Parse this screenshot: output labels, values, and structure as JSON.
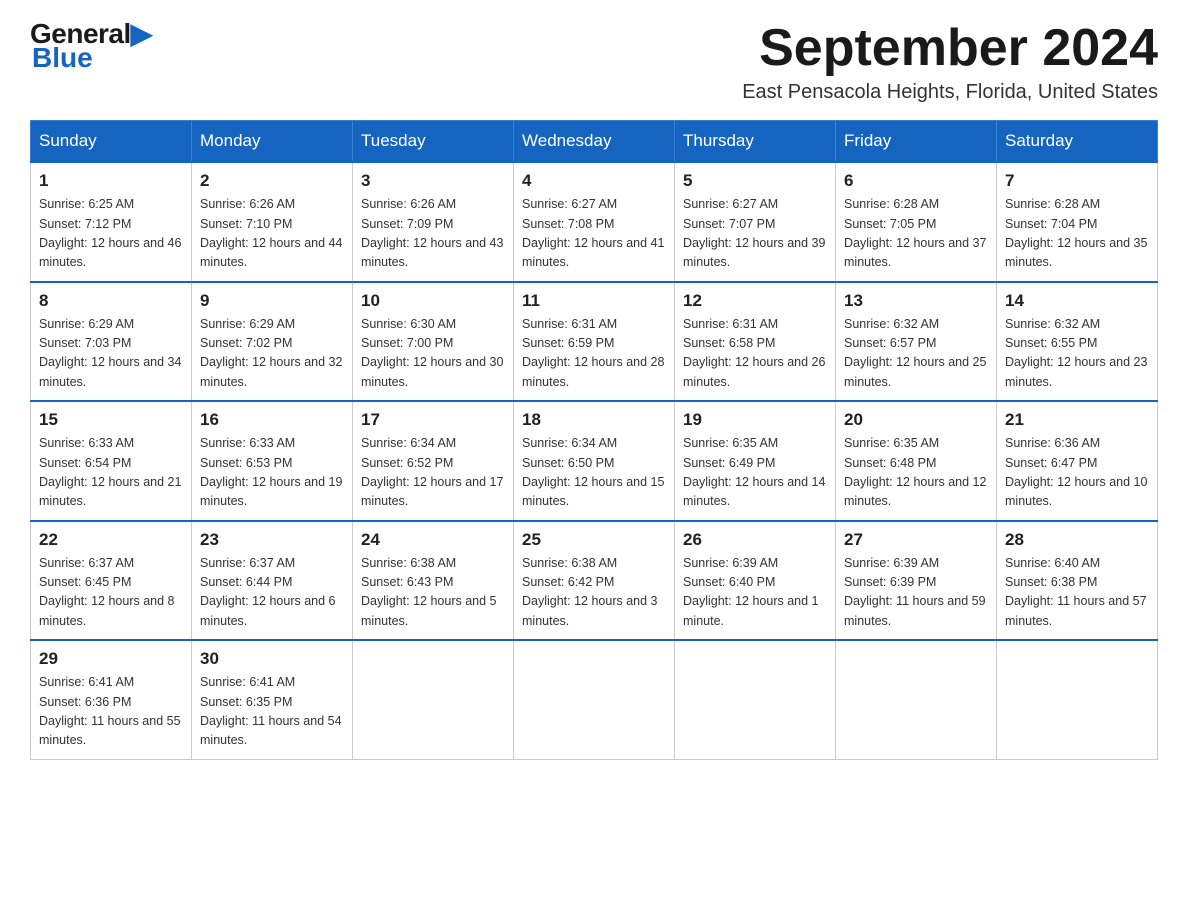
{
  "header": {
    "logo_general": "General",
    "logo_blue": "Blue",
    "month_title": "September 2024",
    "location": "East Pensacola Heights, Florida, United States"
  },
  "weekdays": [
    "Sunday",
    "Monday",
    "Tuesday",
    "Wednesday",
    "Thursday",
    "Friday",
    "Saturday"
  ],
  "weeks": [
    [
      {
        "day": "1",
        "sunrise": "6:25 AM",
        "sunset": "7:12 PM",
        "daylight": "12 hours and 46 minutes."
      },
      {
        "day": "2",
        "sunrise": "6:26 AM",
        "sunset": "7:10 PM",
        "daylight": "12 hours and 44 minutes."
      },
      {
        "day": "3",
        "sunrise": "6:26 AM",
        "sunset": "7:09 PM",
        "daylight": "12 hours and 43 minutes."
      },
      {
        "day": "4",
        "sunrise": "6:27 AM",
        "sunset": "7:08 PM",
        "daylight": "12 hours and 41 minutes."
      },
      {
        "day": "5",
        "sunrise": "6:27 AM",
        "sunset": "7:07 PM",
        "daylight": "12 hours and 39 minutes."
      },
      {
        "day": "6",
        "sunrise": "6:28 AM",
        "sunset": "7:05 PM",
        "daylight": "12 hours and 37 minutes."
      },
      {
        "day": "7",
        "sunrise": "6:28 AM",
        "sunset": "7:04 PM",
        "daylight": "12 hours and 35 minutes."
      }
    ],
    [
      {
        "day": "8",
        "sunrise": "6:29 AM",
        "sunset": "7:03 PM",
        "daylight": "12 hours and 34 minutes."
      },
      {
        "day": "9",
        "sunrise": "6:29 AM",
        "sunset": "7:02 PM",
        "daylight": "12 hours and 32 minutes."
      },
      {
        "day": "10",
        "sunrise": "6:30 AM",
        "sunset": "7:00 PM",
        "daylight": "12 hours and 30 minutes."
      },
      {
        "day": "11",
        "sunrise": "6:31 AM",
        "sunset": "6:59 PM",
        "daylight": "12 hours and 28 minutes."
      },
      {
        "day": "12",
        "sunrise": "6:31 AM",
        "sunset": "6:58 PM",
        "daylight": "12 hours and 26 minutes."
      },
      {
        "day": "13",
        "sunrise": "6:32 AM",
        "sunset": "6:57 PM",
        "daylight": "12 hours and 25 minutes."
      },
      {
        "day": "14",
        "sunrise": "6:32 AM",
        "sunset": "6:55 PM",
        "daylight": "12 hours and 23 minutes."
      }
    ],
    [
      {
        "day": "15",
        "sunrise": "6:33 AM",
        "sunset": "6:54 PM",
        "daylight": "12 hours and 21 minutes."
      },
      {
        "day": "16",
        "sunrise": "6:33 AM",
        "sunset": "6:53 PM",
        "daylight": "12 hours and 19 minutes."
      },
      {
        "day": "17",
        "sunrise": "6:34 AM",
        "sunset": "6:52 PM",
        "daylight": "12 hours and 17 minutes."
      },
      {
        "day": "18",
        "sunrise": "6:34 AM",
        "sunset": "6:50 PM",
        "daylight": "12 hours and 15 minutes."
      },
      {
        "day": "19",
        "sunrise": "6:35 AM",
        "sunset": "6:49 PM",
        "daylight": "12 hours and 14 minutes."
      },
      {
        "day": "20",
        "sunrise": "6:35 AM",
        "sunset": "6:48 PM",
        "daylight": "12 hours and 12 minutes."
      },
      {
        "day": "21",
        "sunrise": "6:36 AM",
        "sunset": "6:47 PM",
        "daylight": "12 hours and 10 minutes."
      }
    ],
    [
      {
        "day": "22",
        "sunrise": "6:37 AM",
        "sunset": "6:45 PM",
        "daylight": "12 hours and 8 minutes."
      },
      {
        "day": "23",
        "sunrise": "6:37 AM",
        "sunset": "6:44 PM",
        "daylight": "12 hours and 6 minutes."
      },
      {
        "day": "24",
        "sunrise": "6:38 AM",
        "sunset": "6:43 PM",
        "daylight": "12 hours and 5 minutes."
      },
      {
        "day": "25",
        "sunrise": "6:38 AM",
        "sunset": "6:42 PM",
        "daylight": "12 hours and 3 minutes."
      },
      {
        "day": "26",
        "sunrise": "6:39 AM",
        "sunset": "6:40 PM",
        "daylight": "12 hours and 1 minute."
      },
      {
        "day": "27",
        "sunrise": "6:39 AM",
        "sunset": "6:39 PM",
        "daylight": "11 hours and 59 minutes."
      },
      {
        "day": "28",
        "sunrise": "6:40 AM",
        "sunset": "6:38 PM",
        "daylight": "11 hours and 57 minutes."
      }
    ],
    [
      {
        "day": "29",
        "sunrise": "6:41 AM",
        "sunset": "6:36 PM",
        "daylight": "11 hours and 55 minutes."
      },
      {
        "day": "30",
        "sunrise": "6:41 AM",
        "sunset": "6:35 PM",
        "daylight": "11 hours and 54 minutes."
      },
      null,
      null,
      null,
      null,
      null
    ]
  ]
}
